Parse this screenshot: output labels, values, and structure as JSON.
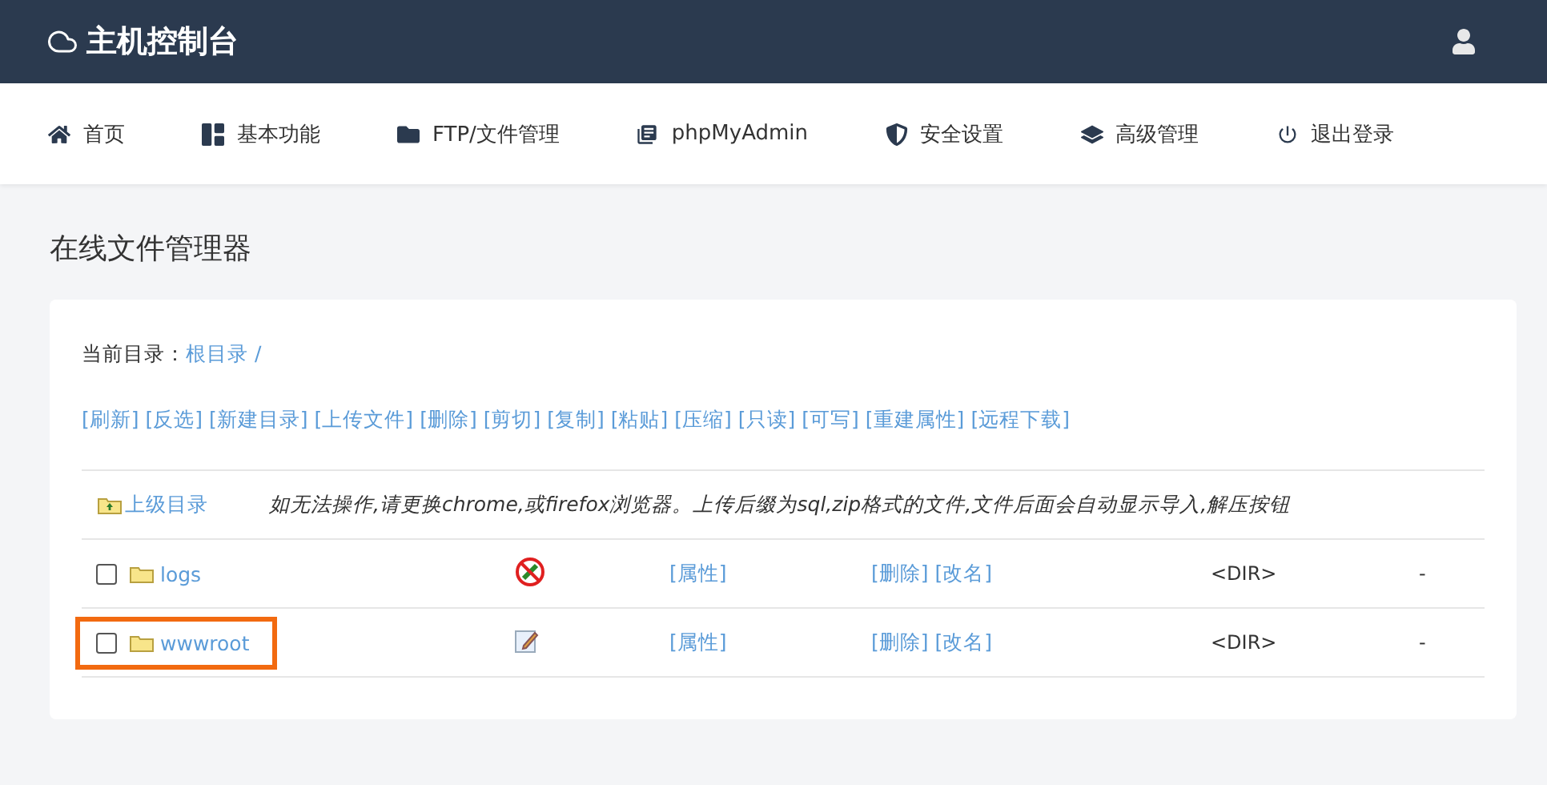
{
  "header": {
    "title": "主机控制台"
  },
  "nav": [
    {
      "label": "首页"
    },
    {
      "label": "基本功能"
    },
    {
      "label": "FTP/文件管理"
    },
    {
      "label": "phpMyAdmin"
    },
    {
      "label": "安全设置"
    },
    {
      "label": "高级管理"
    },
    {
      "label": "退出登录"
    }
  ],
  "page_title": "在线文件管理器",
  "current_dir": {
    "label": "当前目录：",
    "path": "根目录 /"
  },
  "actions": [
    "[刷新]",
    "[反选]",
    "[新建目录]",
    "[上传文件]",
    "[删除]",
    "[剪切]",
    "[复制]",
    "[粘贴]",
    "[压缩]",
    "[只读]",
    "[可写]",
    "[重建属性]",
    "[远程下载]"
  ],
  "parent": {
    "label": "上级目录",
    "notice": "如无法操作,请更换chrome,或firefox浏览器。上传后缀为sql,zip格式的文件,文件后面会自动显示导入,解压按钮"
  },
  "rows": [
    {
      "name": "logs",
      "checked": false,
      "writable": false,
      "highlighted": false,
      "attr": "[属性]",
      "delete": "[删除]",
      "rename": "[改名]",
      "type": "<DIR>",
      "size": "-"
    },
    {
      "name": "wwwroot",
      "checked": false,
      "writable": true,
      "highlighted": true,
      "attr": "[属性]",
      "delete": "[删除]",
      "rename": "[改名]",
      "type": "<DIR>",
      "size": "-"
    }
  ]
}
